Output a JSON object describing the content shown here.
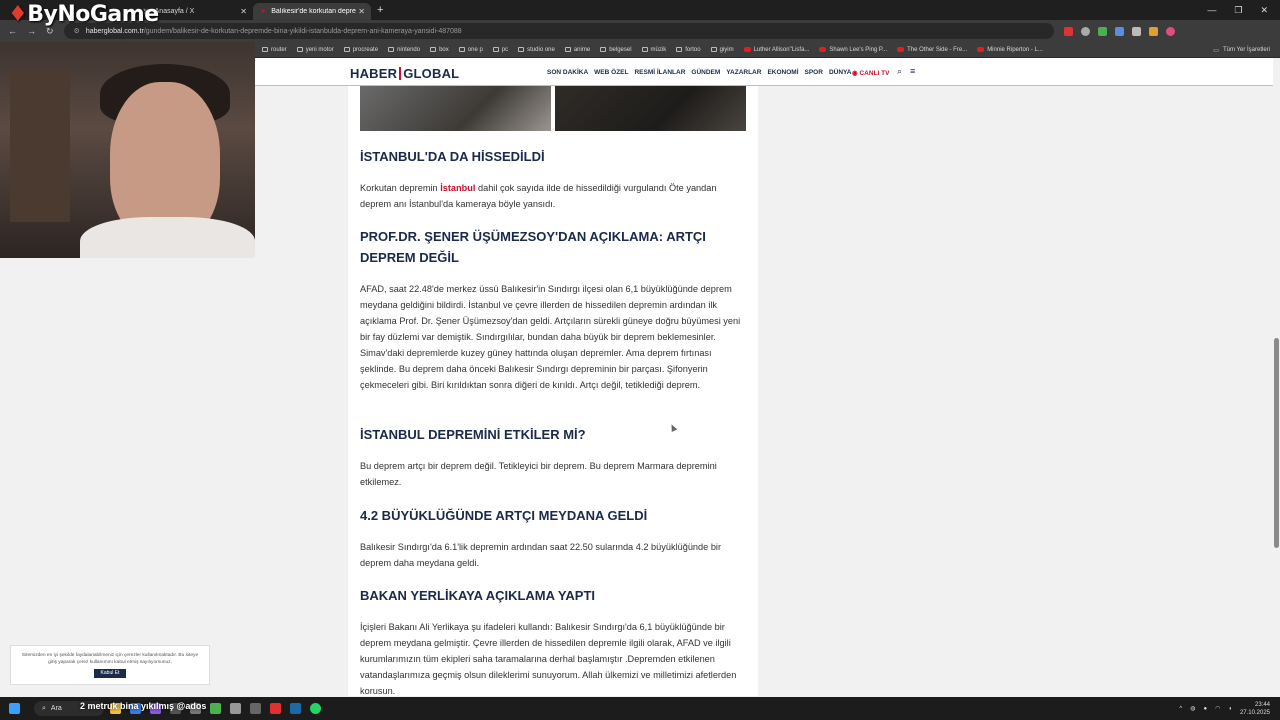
{
  "browser": {
    "tabs": [
      {
        "label": "Anasayfa / X",
        "icon": "x-icon"
      },
      {
        "label": "Balıkesir'de korkutan deprem...",
        "icon": "haberglobal-icon"
      }
    ],
    "url_host": "haberglobal.com.tr",
    "url_path": "/gundem/balikesir-de-korkutan-depremde-bina-yikildi-istanbulda-deprem-ani-kameraya-yansidi-487088",
    "bookmarks": [
      "router",
      "yeni motor",
      "procreate",
      "nintendo",
      "box",
      "one p",
      "pc",
      "studio one",
      "anime",
      "belgesel",
      "müzik",
      "fortoo",
      "giyim",
      "Luther Allison\"Lisfa...",
      "Shawn Lee's Ping P...",
      "The Other Side - Fre...",
      "Minnie Riperton - L..."
    ],
    "bookmarks_right": "Tüm Yer İşaretleri"
  },
  "site": {
    "logo_left": "HABER",
    "logo_right": "GLOBAL",
    "nav": [
      "SON DAKİKA",
      "WEB ÖZEL",
      "RESMİ İLANLAR",
      "GÜNDEM",
      "YAZARLAR",
      "EKONOMİ",
      "SPOR",
      "DÜNYA"
    ],
    "live_tv": "CANLI TV"
  },
  "article": {
    "h1": "İSTANBUL'DA DA HİSSEDİLDİ",
    "p1_before": "Korkutan depremin ",
    "p1_link": "İstanbul",
    "p1_after": " dahil çok sayıda ilde de hissedildiği vurgulandı Öte yandan deprem anı İstanbul'da kameraya böyle yansıdı.",
    "h2": "PROF.DR. ŞENER ÜŞÜMEZSOY'DAN AÇIKLAMA: ARTÇI DEPREM DEĞİL",
    "p2": "AFAD, saat 22.48'de merkez üssü Balıkesir'in Sındırgı ilçesi olan 6,1 büyüklüğünde deprem meydana geldiğini bildirdi. İstanbul ve çevre illerden de hissedilen depremin ardından ilk açıklama Prof. Dr. Şener Üşümezsoy'dan geldi. Artçıların sürekli güneye doğru büyümesi yeni bir fay düzlemi var demiştik. Sındırgılılar, bundan daha büyük bir deprem beklemesinler. Simav'daki depremlerde kuzey güney hattında oluşan depremler. Ama deprem fırtınası şeklinde. Bu deprem daha önceki Balıkesir Sındırgı depreminin bir parçası. Şifonyerin çekmeceleri gibi. Biri kırıldıktan sonra diğeri de kırıldı. Artçı değil, tetiklediği deprem.",
    "h3": "İSTANBUL DEPREMİNİ ETKİLER Mİ?",
    "p3": "Bu deprem artçı bir deprem değil. Tetikleyici bir deprem. Bu deprem Marmara depremini etkilemez.",
    "h4": "4.2 BÜYÜKLÜĞÜNDE ARTÇI MEYDANA GELDİ",
    "p4": "Balıkesir Sındırgı'da 6.1'lik depremin ardından saat 22.50 sularında 4.2 büyüklüğünde bir deprem daha meydana geldi.",
    "h5": "BAKAN YERLİKAYA AÇIKLAMA YAPTI",
    "p5": "İçişleri Bakanı Ali Yerlikaya şu ifadeleri kullandı: Balıkesir Sındırgı'da 6,1 büyüklüğünde bir deprem meydana gelmiştir. Çevre illerden de hissedilen depremle ilgili olarak, AFAD ve ilgili kurumlarımızın tüm ekipleri saha taramalarına derhal başlamıştır .Depremden etkilenen vatandaşlarımıza geçmiş olsun dileklerimi sunuyorum. Allah ülkemizi ve milletimizi afetlerden korusun."
  },
  "cookie": {
    "text": "Sitemizden en iyi şekilde faydalanabilmeniz için çerezler kullanılmaktadır. Bu siteye giriş yaparak çerez kullanımını kabul etmiş sayılıyorsunuz.",
    "button": "Kabul Et"
  },
  "stream": {
    "brand": "ByNoGame",
    "overlay": "2 metruk bina yıkılmış @ados"
  },
  "taskbar": {
    "search": "Ara",
    "time": "23:44",
    "date": "27.10.2025"
  }
}
